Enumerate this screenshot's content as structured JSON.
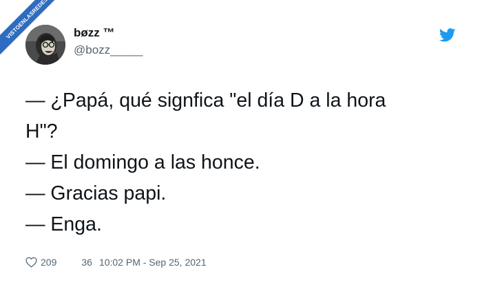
{
  "watermark": {
    "text": "VISTOENLASREDES"
  },
  "header": {
    "display_name": "bøzz ™",
    "handle": "@bozz_____"
  },
  "tweet": {
    "lines": [
      "— ¿Papá, qué signfica \"el día D a la hora",
      "H\"?",
      "— El domingo a las honce.",
      "— Gracias papi.",
      "— Enga."
    ]
  },
  "footer": {
    "likes": "209",
    "replies": "36",
    "timestamp": "10:02 PM - Sep 25, 2021"
  },
  "colors": {
    "twitter_blue": "#1d9bf0",
    "text_primary": "#0f1419",
    "text_secondary": "#536471",
    "watermark_blue": "#2d6cc0"
  },
  "icons": {
    "brand": "twitter-bird-icon",
    "like": "heart-icon"
  }
}
